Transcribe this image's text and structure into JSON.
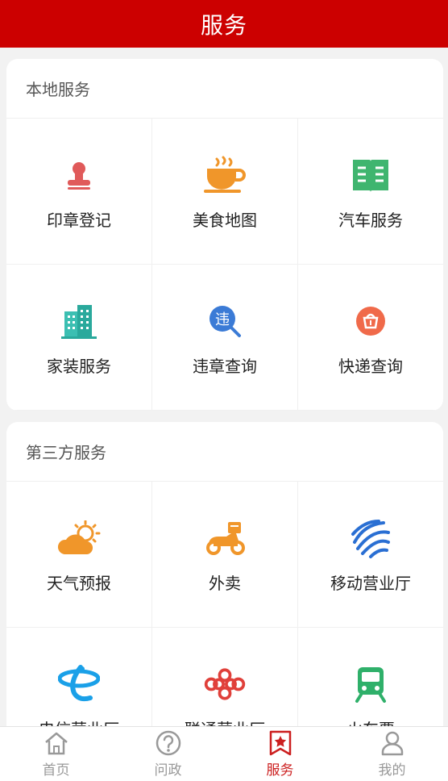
{
  "header": {
    "title": "服务"
  },
  "local": {
    "title": "本地服务",
    "items": [
      {
        "label": "印章登记",
        "icon": "stamp-icon"
      },
      {
        "label": "美食地图",
        "icon": "coffee-cup-icon"
      },
      {
        "label": "汽车服务",
        "icon": "book-icon"
      },
      {
        "label": "家装服务",
        "icon": "building-icon"
      },
      {
        "label": "违章查询",
        "icon": "violation-search-icon"
      },
      {
        "label": "快递查询",
        "icon": "delivery-basket-icon"
      }
    ],
    "violation_glyph": "违"
  },
  "third": {
    "title": "第三方服务",
    "items": [
      {
        "label": "天气预报",
        "icon": "weather-icon"
      },
      {
        "label": "外卖",
        "icon": "scooter-icon"
      },
      {
        "label": "移动营业厅",
        "icon": "china-mobile-icon"
      },
      {
        "label": "电信营业厅",
        "icon": "china-telecom-icon"
      },
      {
        "label": "联通营业厅",
        "icon": "china-unicom-icon"
      },
      {
        "label": "火车票",
        "icon": "train-icon"
      }
    ]
  },
  "tabbar": {
    "items": [
      {
        "label": "首页",
        "icon": "home-icon"
      },
      {
        "label": "问政",
        "icon": "question-icon"
      },
      {
        "label": "服务",
        "icon": "star-bookmark-icon",
        "active": true
      },
      {
        "label": "我的",
        "icon": "user-icon"
      }
    ]
  },
  "colors": {
    "brand": "#cc0000",
    "active_tab": "#cc1f1f"
  }
}
